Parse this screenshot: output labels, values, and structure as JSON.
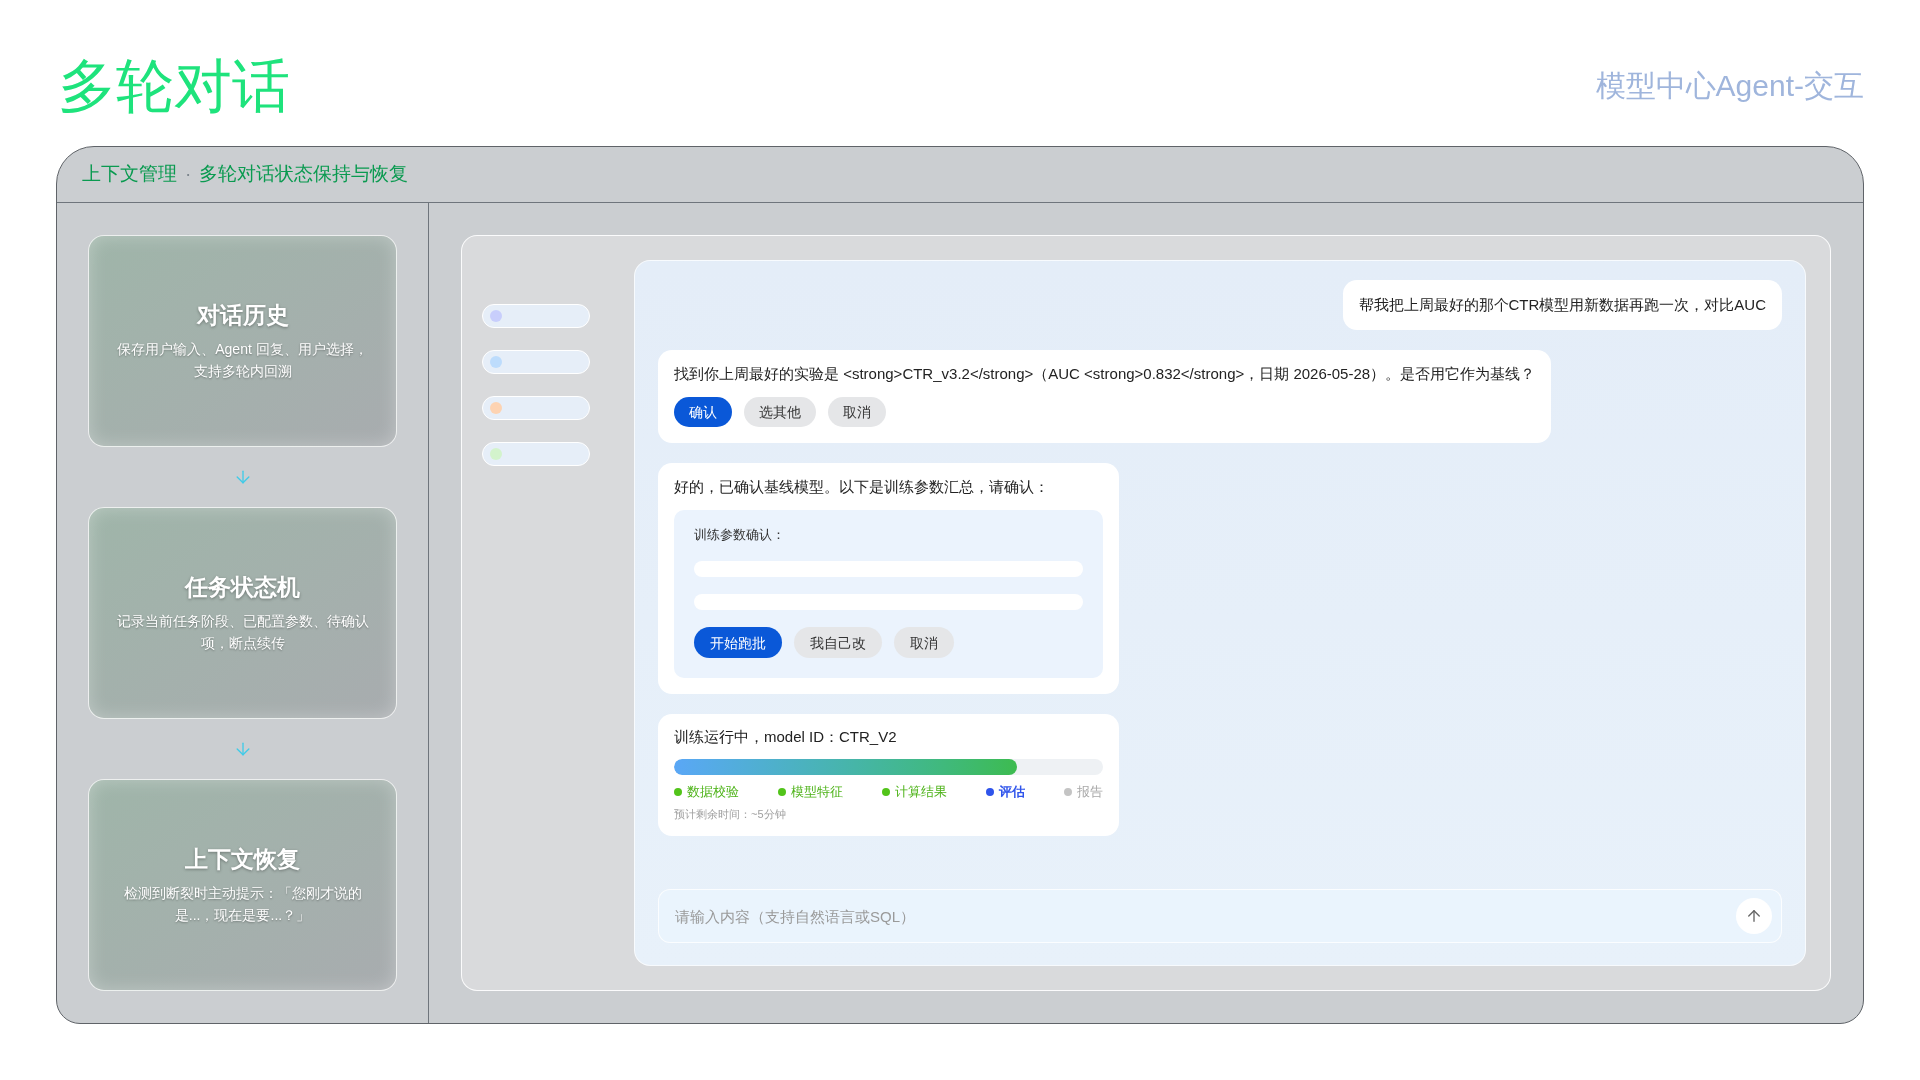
{
  "page": {
    "title": "多轮对话",
    "subtitle": "模型中心Agent-交互"
  },
  "panel": {
    "breadcrumb": [
      "上下文管理",
      "多轮对话状态保持与恢复"
    ],
    "separator": "·"
  },
  "cards": [
    {
      "title": "对话历史",
      "description": "保存用户输入、Agent 回复、用户选择，支持多轮内回溯"
    },
    {
      "title": "任务状态机",
      "description": "记录当前任务阶段、已配置参数、待确认项，断点续传"
    },
    {
      "title": "上下文恢复",
      "description": "检测到断裂时主动提示：「您刚才说的是...，现在是要...？」"
    }
  ],
  "chat": {
    "sidebar": [
      {
        "color": "#c8cefc"
      },
      {
        "color": "#bddcfc"
      },
      {
        "color": "#fdd3b2"
      },
      {
        "color": "#d3f3cc"
      }
    ],
    "messages": [
      {
        "kind": "user",
        "text": "帮我把上周最好的那个CTR模型用新数据再跑一次，对比AUC"
      },
      {
        "kind": "choice",
        "text": "找到你上周最好的实验是 <strong>CTR_v3.2</strong>（AUC <strong>0.832</strong>，日期 2026-05-28）。是否用它作为基线？",
        "buttons": [
          {
            "label": "确认",
            "kind": "primary"
          },
          {
            "label": "选其他",
            "kind": "secondary"
          },
          {
            "label": "取消",
            "kind": "secondary"
          }
        ]
      },
      {
        "kind": "form",
        "text": "好的，已确认基线模型。以下是训练参数汇总，请确认：",
        "form_title": "训练参数确认：",
        "buttons": [
          {
            "label": "开始跑批",
            "kind": "primary"
          },
          {
            "label": "我自己改",
            "kind": "secondary"
          },
          {
            "label": "取消",
            "kind": "secondary"
          }
        ]
      },
      {
        "kind": "progress",
        "text": "训练运行中，model ID：CTR_V2",
        "level": 0.8,
        "stages": [
          {
            "label": "数据校验",
            "done": true,
            "active": false
          },
          {
            "label": "模型特征",
            "done": true,
            "active": false
          },
          {
            "label": "计算结果",
            "done": true,
            "active": false
          },
          {
            "label": "评估",
            "done": false,
            "active": true
          },
          {
            "label": "报告",
            "done": false,
            "active": false
          }
        ],
        "eta": "预计剩余时间：~5分钟"
      }
    ],
    "input": {
      "placeholder": "请输入内容（支持自然语言或SQL）"
    }
  }
}
